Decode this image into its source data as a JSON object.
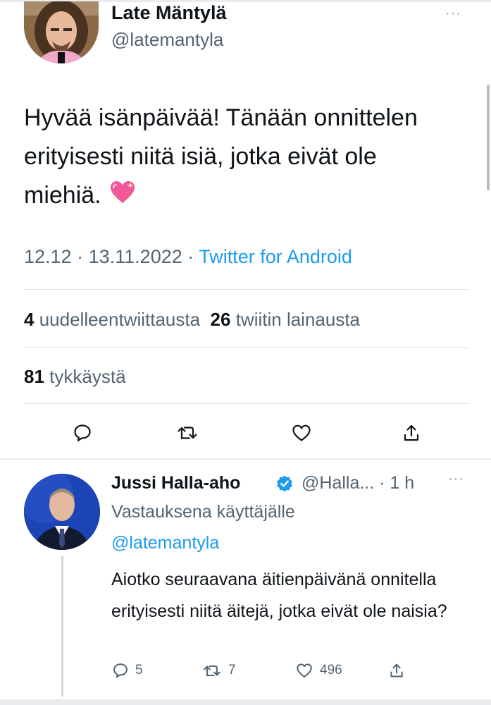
{
  "main_tweet": {
    "author_name": "Late Mäntylä",
    "author_handle": "@latemantyla",
    "more_glyph": "···",
    "text": "Hyvää isänpäivää! Tänään onnittelen erityisesti niitä isiä, jotka eivät ole miehiä.",
    "emoji_icon": "sparkling-heart-icon",
    "time": "12.12",
    "date": "13.11.2022",
    "separator": "·",
    "source": "Twitter for Android",
    "retweets_count": "4",
    "retweets_label": "uudelleentwiittausta",
    "quotes_count": "26",
    "quotes_label": "twiitin lainausta",
    "likes_count": "81",
    "likes_label": "tykkäystä"
  },
  "reply": {
    "author_name": "Jussi Halla-aho",
    "verified_icon": "verified-badge-icon",
    "author_handle": "@Halla...",
    "time": "· 1 h",
    "more_glyph": "···",
    "reply_to_label": "Vastauksena käyttäjälle",
    "reply_to_handle": "@latemantyla",
    "text": "Aiotko seuraavana äitienpäivänä onnitella erityisesti niitä äitejä, jotka eivät ole naisia?",
    "replies_count": "5",
    "retweets_count": "7",
    "likes_count": "496"
  },
  "colors": {
    "link": "#1d9bf0",
    "secondary_text": "#536471",
    "primary_text": "#0f1419",
    "verified": "#1d9bf0",
    "heart_emoji": "#f0589a"
  }
}
